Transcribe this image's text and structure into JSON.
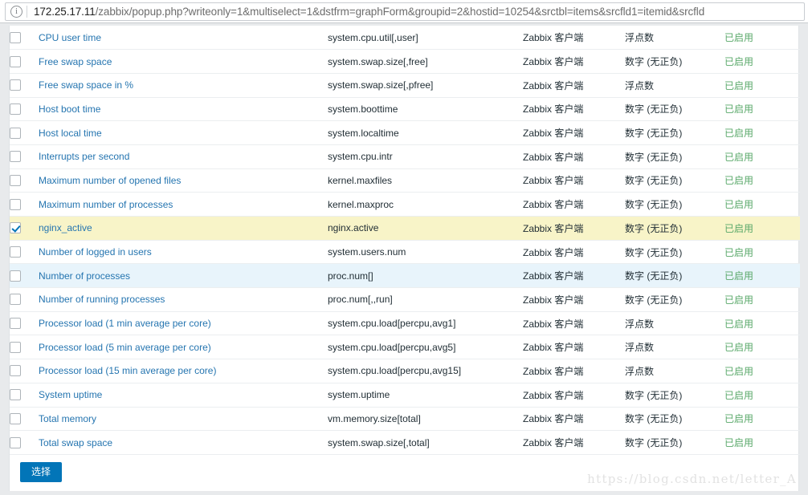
{
  "browser": {
    "info_icon": "info-circle-icon",
    "url_host": "172.25.17.11",
    "url_path": "/zabbix/popup.php?writeonly=1&multiselect=1&dstfrm=graphForm&groupid=2&hostid=10254&srctbl=items&srcfld1=itemid&srcfld"
  },
  "table": {
    "rows": [
      {
        "name": "CPU user time",
        "key": "system.cpu.util[,user]",
        "type": "Zabbix 客户端",
        "value_type": "浮点数",
        "status": "已启用",
        "checked": false,
        "state": "normal"
      },
      {
        "name": "Free swap space",
        "key": "system.swap.size[,free]",
        "type": "Zabbix 客户端",
        "value_type": "数字 (无正负)",
        "status": "已启用",
        "checked": false,
        "state": "normal"
      },
      {
        "name": "Free swap space in %",
        "key": "system.swap.size[,pfree]",
        "type": "Zabbix 客户端",
        "value_type": "浮点数",
        "status": "已启用",
        "checked": false,
        "state": "normal"
      },
      {
        "name": "Host boot time",
        "key": "system.boottime",
        "type": "Zabbix 客户端",
        "value_type": "数字 (无正负)",
        "status": "已启用",
        "checked": false,
        "state": "normal"
      },
      {
        "name": "Host local time",
        "key": "system.localtime",
        "type": "Zabbix 客户端",
        "value_type": "数字 (无正负)",
        "status": "已启用",
        "checked": false,
        "state": "normal"
      },
      {
        "name": "Interrupts per second",
        "key": "system.cpu.intr",
        "type": "Zabbix 客户端",
        "value_type": "数字 (无正负)",
        "status": "已启用",
        "checked": false,
        "state": "normal"
      },
      {
        "name": "Maximum number of opened files",
        "key": "kernel.maxfiles",
        "type": "Zabbix 客户端",
        "value_type": "数字 (无正负)",
        "status": "已启用",
        "checked": false,
        "state": "normal"
      },
      {
        "name": "Maximum number of processes",
        "key": "kernel.maxproc",
        "type": "Zabbix 客户端",
        "value_type": "数字 (无正负)",
        "status": "已启用",
        "checked": false,
        "state": "normal"
      },
      {
        "name": "nginx_active",
        "key": "nginx.active",
        "type": "Zabbix 客户端",
        "value_type": "数字 (无正负)",
        "status": "已启用",
        "checked": true,
        "state": "selected"
      },
      {
        "name": "Number of logged in users",
        "key": "system.users.num",
        "type": "Zabbix 客户端",
        "value_type": "数字 (无正负)",
        "status": "已启用",
        "checked": false,
        "state": "normal"
      },
      {
        "name": "Number of processes",
        "key": "proc.num[]",
        "type": "Zabbix 客户端",
        "value_type": "数字 (无正负)",
        "status": "已启用",
        "checked": false,
        "state": "hover"
      },
      {
        "name": "Number of running processes",
        "key": "proc.num[,,run]",
        "type": "Zabbix 客户端",
        "value_type": "数字 (无正负)",
        "status": "已启用",
        "checked": false,
        "state": "normal"
      },
      {
        "name": "Processor load (1 min average per core)",
        "key": "system.cpu.load[percpu,avg1]",
        "type": "Zabbix 客户端",
        "value_type": "浮点数",
        "status": "已启用",
        "checked": false,
        "state": "normal"
      },
      {
        "name": "Processor load (5 min average per core)",
        "key": "system.cpu.load[percpu,avg5]",
        "type": "Zabbix 客户端",
        "value_type": "浮点数",
        "status": "已启用",
        "checked": false,
        "state": "normal"
      },
      {
        "name": "Processor load (15 min average per core)",
        "key": "system.cpu.load[percpu,avg15]",
        "type": "Zabbix 客户端",
        "value_type": "浮点数",
        "status": "已启用",
        "checked": false,
        "state": "normal"
      },
      {
        "name": "System uptime",
        "key": "system.uptime",
        "type": "Zabbix 客户端",
        "value_type": "数字 (无正负)",
        "status": "已启用",
        "checked": false,
        "state": "normal"
      },
      {
        "name": "Total memory",
        "key": "vm.memory.size[total]",
        "type": "Zabbix 客户端",
        "value_type": "数字 (无正负)",
        "status": "已启用",
        "checked": false,
        "state": "normal"
      },
      {
        "name": "Total swap space",
        "key": "system.swap.size[,total]",
        "type": "Zabbix 客户端",
        "value_type": "数字 (无正负)",
        "status": "已启用",
        "checked": false,
        "state": "normal"
      }
    ]
  },
  "footer": {
    "select_button": "选择"
  },
  "watermark": {
    "text": "https://blog.csdn.net/letter_A"
  },
  "colors": {
    "link": "#2575b0",
    "button": "#0275b8",
    "status_enabled": "#59a869",
    "row_selected": "#f8f4c8",
    "row_hover": "#e8f4fb"
  }
}
